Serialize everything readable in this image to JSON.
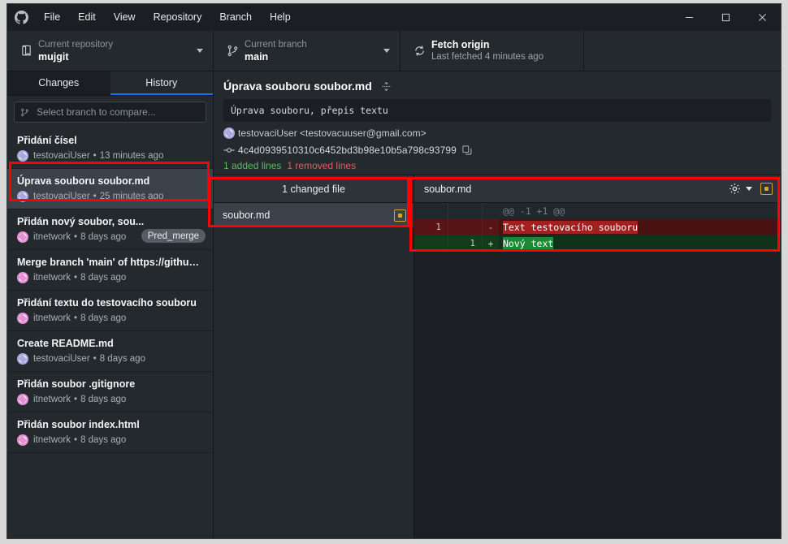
{
  "window": {
    "app_title": "GitHub Desktop",
    "minimize_label": "Minimize",
    "maximize_label": "Maximize",
    "close_label": "Close"
  },
  "menubar": {
    "items": [
      {
        "label": "File"
      },
      {
        "label": "Edit"
      },
      {
        "label": "View"
      },
      {
        "label": "Repository"
      },
      {
        "label": "Branch"
      },
      {
        "label": "Help"
      }
    ]
  },
  "toolbar": {
    "repository": {
      "label": "Current repository",
      "value": "mujgit"
    },
    "branch": {
      "label": "Current branch",
      "value": "main"
    },
    "fetch": {
      "title": "Fetch origin",
      "subtitle": "Last fetched 4 minutes ago"
    }
  },
  "sidebar": {
    "tabs": [
      {
        "label": "Changes",
        "active": false
      },
      {
        "label": "History",
        "active": true
      }
    ],
    "compare": {
      "placeholder": "Select branch to compare..."
    },
    "commits": [
      {
        "title": "Přidání čísel",
        "author": "testovaciUser",
        "time": "13 minutes ago",
        "separator": "•",
        "avatar": "purple",
        "tag": "",
        "selected": false
      },
      {
        "title": "Úprava souboru soubor.md",
        "author": "testovaciUser",
        "time": "25 minutes ago",
        "separator": "•",
        "avatar": "purple",
        "tag": "",
        "selected": true
      },
      {
        "title": "Přidán nový soubor, sou...",
        "author": "itnetwork",
        "time": "8 days ago",
        "separator": "•",
        "avatar": "pink",
        "tag": "Pred_merge",
        "selected": false
      },
      {
        "title": "Merge branch 'main' of https://github....",
        "author": "itnetwork",
        "time": "8 days ago",
        "separator": "•",
        "avatar": "pink",
        "tag": "",
        "selected": false
      },
      {
        "title": "Přidání textu do testovacího souboru",
        "author": "itnetwork",
        "time": "8 days ago",
        "separator": "•",
        "avatar": "pink",
        "tag": "",
        "selected": false
      },
      {
        "title": "Create README.md",
        "author": "testovaciUser",
        "time": "8 days ago",
        "separator": "•",
        "avatar": "purple",
        "tag": "",
        "selected": false
      },
      {
        "title": "Přidán soubor .gitignore",
        "author": "itnetwork",
        "time": "8 days ago",
        "separator": "•",
        "avatar": "pink",
        "tag": "",
        "selected": false
      },
      {
        "title": "Přidán soubor index.html",
        "author": "itnetwork",
        "time": "8 days ago",
        "separator": "•",
        "avatar": "pink",
        "tag": "",
        "selected": false
      }
    ]
  },
  "commit_detail": {
    "title": "Úprava souboru soubor.md",
    "description": "Úprava souboru, přepis textu",
    "author_line": "testovaciUser <testovacuuser@gmail.com>",
    "hash": "4c4d0939510310c6452bd3b98e10b5a798c93799",
    "added_lines": "1 added lines",
    "removed_lines": "1 removed lines"
  },
  "files_pane": {
    "header": "1 changed file",
    "files": [
      {
        "name": "soubor.md",
        "status": "modified"
      }
    ]
  },
  "diff": {
    "filename": "soubor.md",
    "lines": [
      {
        "kind": "hunk",
        "old_ln": "",
        "new_ln": "",
        "marker": "",
        "text": "@@ -1 +1 @@"
      },
      {
        "kind": "del",
        "old_ln": "1",
        "new_ln": "",
        "marker": "-",
        "text": "Text testovacího souboru"
      },
      {
        "kind": "add",
        "old_ln": "",
        "new_ln": "1",
        "marker": "+",
        "text": "Nový text"
      }
    ]
  },
  "colors": {
    "accent": "#1f6feb",
    "added": "#5fb868",
    "removed": "#d9635f",
    "modified_status": "#d9a520",
    "annotation": "#ff0000"
  }
}
